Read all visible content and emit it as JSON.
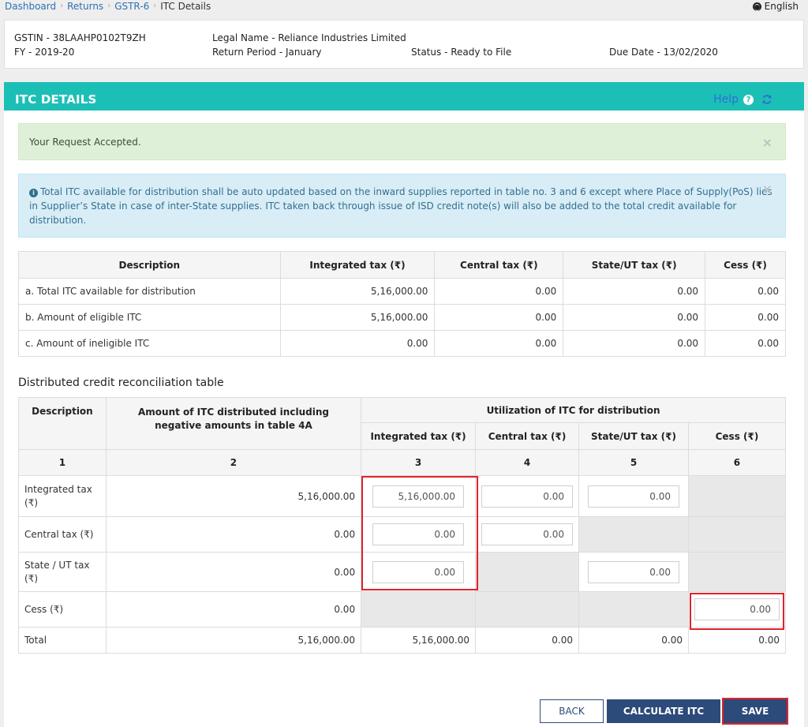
{
  "breadcrumb": {
    "items": [
      "Dashboard",
      "Returns",
      "GSTR-6"
    ],
    "current": "ITC Details"
  },
  "language": "English",
  "info": {
    "gstin": "GSTIN - 38LAAHP0102T9ZH",
    "fy": "FY - 2019-20",
    "legal_name": "Legal Name - Reliance Industries Limited",
    "return_period": "Return Period - January",
    "status": "Status - Ready to File",
    "due_date": "Due Date - 13/02/2020"
  },
  "panel": {
    "title": "ITC DETAILS",
    "help": "Help",
    "help_glyph": "?"
  },
  "alerts": {
    "success": "Your Request Accepted.",
    "info": "Total ITC available for distribution shall be auto updated based on the inward supplies reported in table no. 3 and 6 except where Place of Supply(PoS) lies in Supplier’s State in case of inter-State supplies. ITC taken back through issue of ISD credit note(s) will also be added to the total credit available for distribution.",
    "close_glyph": "×",
    "info_glyph": "i"
  },
  "summary_table": {
    "headers": [
      "Description",
      "Integrated tax (₹)",
      "Central tax (₹)",
      "State/UT tax (₹)",
      "Cess (₹)"
    ],
    "rows": [
      [
        "a. Total ITC available for distribution",
        "5,16,000.00",
        "0.00",
        "0.00",
        "0.00"
      ],
      [
        "b. Amount of eligible ITC",
        "5,16,000.00",
        "0.00",
        "0.00",
        "0.00"
      ],
      [
        "c. Amount of ineligible ITC",
        "0.00",
        "0.00",
        "0.00",
        "0.00"
      ]
    ]
  },
  "recon": {
    "title": "Distributed credit reconciliation table",
    "headers": {
      "description": "Description",
      "amount": "Amount of ITC distributed including negative amounts in table 4A",
      "utilization": "Utilization of ITC for distribution",
      "sub": [
        "Integrated tax (₹)",
        "Central tax (₹)",
        "State/UT tax (₹)",
        "Cess (₹)"
      ],
      "numbers": [
        "1",
        "2",
        "3",
        "4",
        "5",
        "6"
      ]
    },
    "rows": [
      {
        "label": "Integrated tax (₹)",
        "amount": "5,16,000.00",
        "cells": [
          "5,16,000.00",
          "0.00",
          "0.00",
          null
        ]
      },
      {
        "label": "Central tax (₹)",
        "amount": "0.00",
        "cells": [
          "0.00",
          "0.00",
          null,
          null
        ]
      },
      {
        "label": "State / UT tax (₹)",
        "amount": "0.00",
        "cells": [
          "0.00",
          null,
          "0.00",
          null
        ]
      },
      {
        "label": "Cess (₹)",
        "amount": "0.00",
        "cells": [
          null,
          null,
          null,
          "0.00"
        ]
      }
    ],
    "total": {
      "label": "Total",
      "values": [
        "5,16,000.00",
        "5,16,000.00",
        "0.00",
        "0.00",
        "0.00"
      ]
    }
  },
  "buttons": {
    "back": "BACK",
    "calculate": "CALCULATE ITC",
    "save": "SAVE"
  },
  "colors": {
    "header": "#1cbfb6",
    "primary_button": "#2c4a7a",
    "highlight": "#e0222b"
  }
}
